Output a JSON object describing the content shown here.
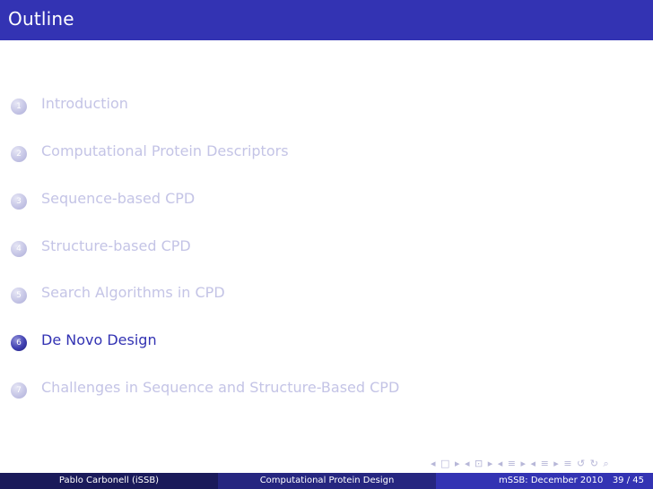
{
  "title": "Outline",
  "outline": [
    {
      "num": "1",
      "label": "Introduction",
      "active": false
    },
    {
      "num": "2",
      "label": "Computational Protein Descriptors",
      "active": false
    },
    {
      "num": "3",
      "label": "Sequence-based CPD",
      "active": false
    },
    {
      "num": "4",
      "label": "Structure-based CPD",
      "active": false
    },
    {
      "num": "5",
      "label": "Search Algorithms in CPD",
      "active": false
    },
    {
      "num": "6",
      "label": "De Novo Design",
      "active": true
    },
    {
      "num": "7",
      "label": "Challenges in Sequence and Structure-Based CPD",
      "active": false
    }
  ],
  "nav_icons": [
    "◂",
    "□",
    "▸",
    "◂",
    "⊡",
    "▸",
    "◂",
    "≡",
    "▸",
    "◂",
    "≡",
    "▸",
    "≡",
    "↺",
    "↻",
    "⌕"
  ],
  "footer": {
    "author": "Pablo Carbonell  (iSSB)",
    "title": "Computational Protein Design",
    "date": "mSSB: December 2010",
    "page": "39 / 45"
  },
  "colors": {
    "accent": "#3333b3",
    "inactive_text": "#c4c4e6",
    "footer_left": "#1a1a5a",
    "footer_mid": "#262680",
    "footer_right": "#3333b3"
  }
}
